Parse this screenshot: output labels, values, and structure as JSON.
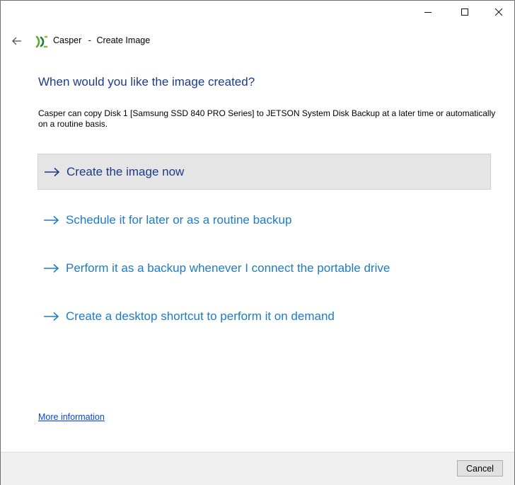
{
  "window": {
    "app_name": "Casper",
    "title_separator": "-",
    "page_name": "Create Image"
  },
  "heading": "When would you like the image created?",
  "description": "Casper can copy Disk 1 [Samsung SSD 840 PRO Series] to JETSON System Disk Backup at a later time or automatically on a routine basis.",
  "options": [
    {
      "label": "Create the image now",
      "selected": true
    },
    {
      "label": "Schedule it for later or as a routine backup",
      "selected": false
    },
    {
      "label": "Perform it as a backup whenever I connect the portable drive",
      "selected": false
    },
    {
      "label": "Create a desktop shortcut to perform it on demand",
      "selected": false
    }
  ],
  "more_information_link": "More information",
  "footer": {
    "cancel_label": "Cancel"
  },
  "colors": {
    "heading": "#1b3b8a",
    "option_link": "#1e7bc4",
    "selected_bg": "#e5e5e5",
    "link": "#0645d8",
    "logo_green": "#6ab42d"
  },
  "icons": {
    "back": "back-arrow-icon",
    "logo": "casper-logo-icon",
    "minimize": "minimize-icon",
    "maximize": "maximize-icon",
    "close": "close-icon",
    "option_arrow": "arrow-right-icon"
  }
}
